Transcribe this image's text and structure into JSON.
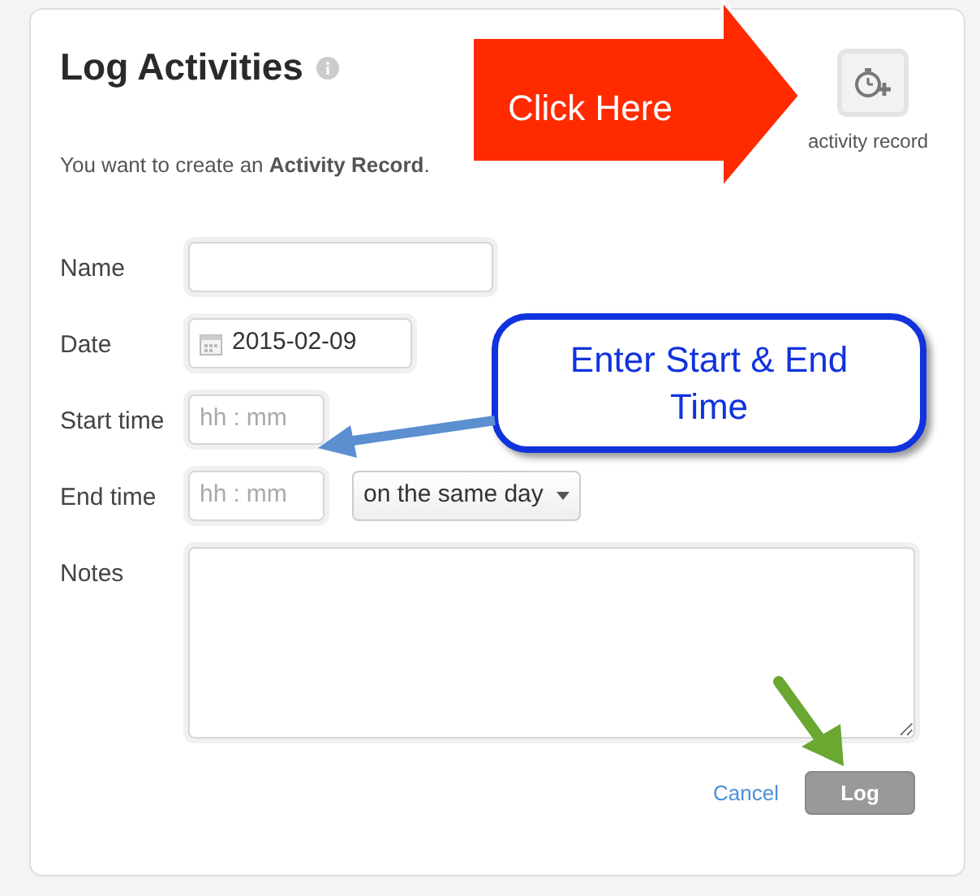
{
  "title": "Log Activities",
  "subtitle": "You want to create an **Activity Record**.",
  "record_button": {
    "label": "activity record"
  },
  "fields": [
    {
      "kind": "text",
      "label": "Name"
    },
    {
      "kind": "date",
      "label": "Date",
      "value": "2015-02-09"
    },
    {
      "kind": "time",
      "label": "Start time",
      "hour_placeholder": "hh",
      "separator": ":",
      "minute_placeholder": "mm"
    },
    {
      "kind": "time",
      "label": "End time",
      "hour_placeholder": "hh",
      "separator": ":",
      "minute_placeholder": "mm",
      "select": "on the same day"
    },
    {
      "kind": "textarea",
      "label": "Notes"
    }
  ],
  "cancel": "Cancel",
  "submit": "Log",
  "callouts": [
    {
      "kind": "red-arrow",
      "text": "Click Here"
    },
    {
      "kind": "bubble",
      "text": "Enter Start & End Time"
    }
  ]
}
